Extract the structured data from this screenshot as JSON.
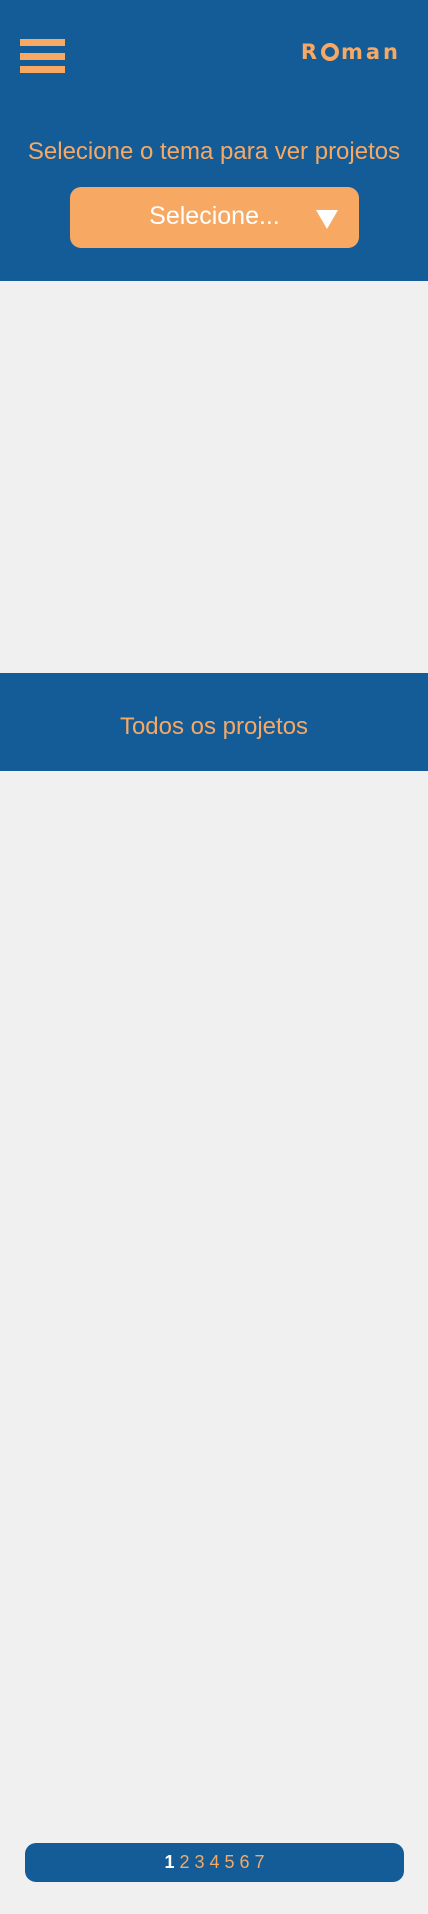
{
  "header": {
    "logo_text_before": "R",
    "logo_text_after": "man",
    "theme_prompt": "Selecione o tema para ver projetos",
    "select_value": "Selecione..."
  },
  "projects": {
    "title": "Todos os projetos"
  },
  "pagination": {
    "pages": [
      "1",
      "2",
      "3",
      "4",
      "5",
      "6",
      "7"
    ],
    "current": "1"
  },
  "colors": {
    "primary": "#135c97",
    "accent": "#f7a964",
    "background": "#f0f0f0",
    "text_light": "#ffffff"
  },
  "icons": {
    "menu": "hamburger-menu-icon",
    "dropdown": "triangle-down-icon",
    "logo_mark": "o-circle-mark"
  }
}
